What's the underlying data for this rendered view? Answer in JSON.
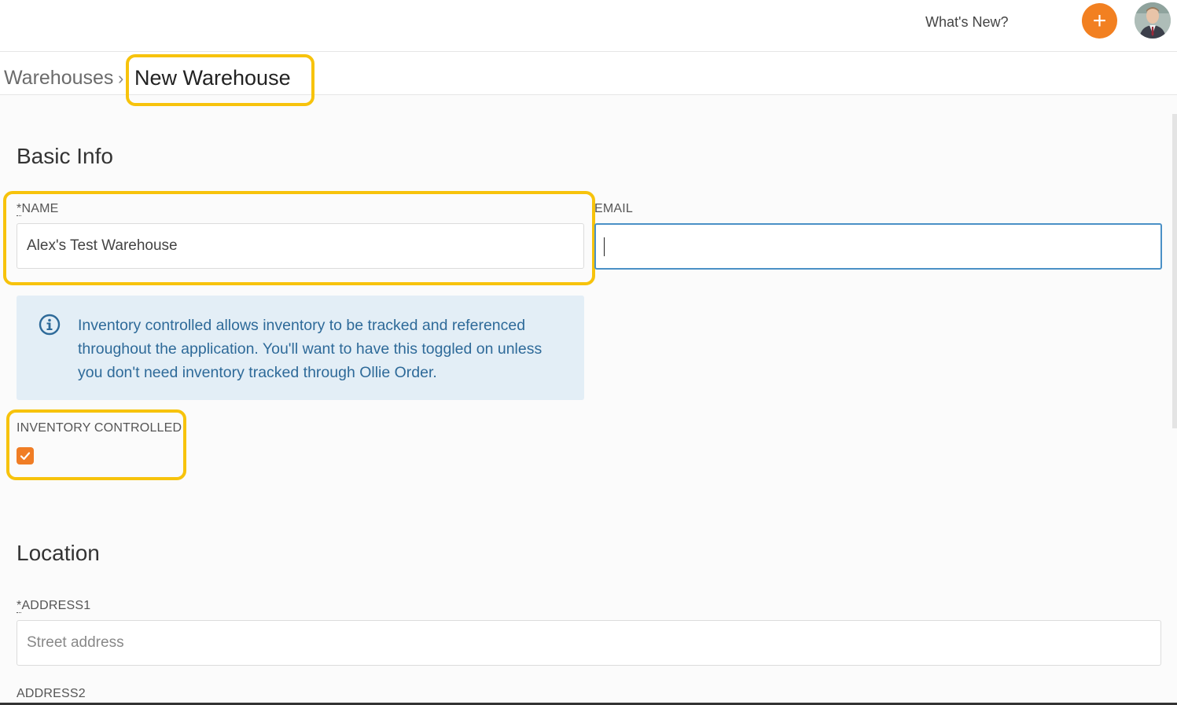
{
  "header": {
    "whats_new": "What's New?",
    "add_button": "+",
    "accent_color": "#f28021"
  },
  "breadcrumb": {
    "parent": "Warehouses",
    "separator": "›",
    "current": "New Warehouse"
  },
  "basic_info": {
    "title": "Basic Info",
    "name": {
      "required_mark": "*",
      "label": "NAME",
      "value": "Alex's Test Warehouse"
    },
    "email": {
      "label": "EMAIL",
      "value": ""
    },
    "info_message": "Inventory controlled allows inventory to be tracked and referenced throughout the application. You'll want to have this toggled on unless you don't need inventory tracked through Ollie Order.",
    "inventory_controlled": {
      "label": "INVENTORY CONTROLLED",
      "checked": true
    }
  },
  "location": {
    "title": "Location",
    "address1": {
      "required_mark": "*",
      "label": "ADDRESS1",
      "placeholder": "Street address"
    },
    "address2": {
      "label": "ADDRESS2"
    }
  },
  "highlight_color": "#f7c30c"
}
